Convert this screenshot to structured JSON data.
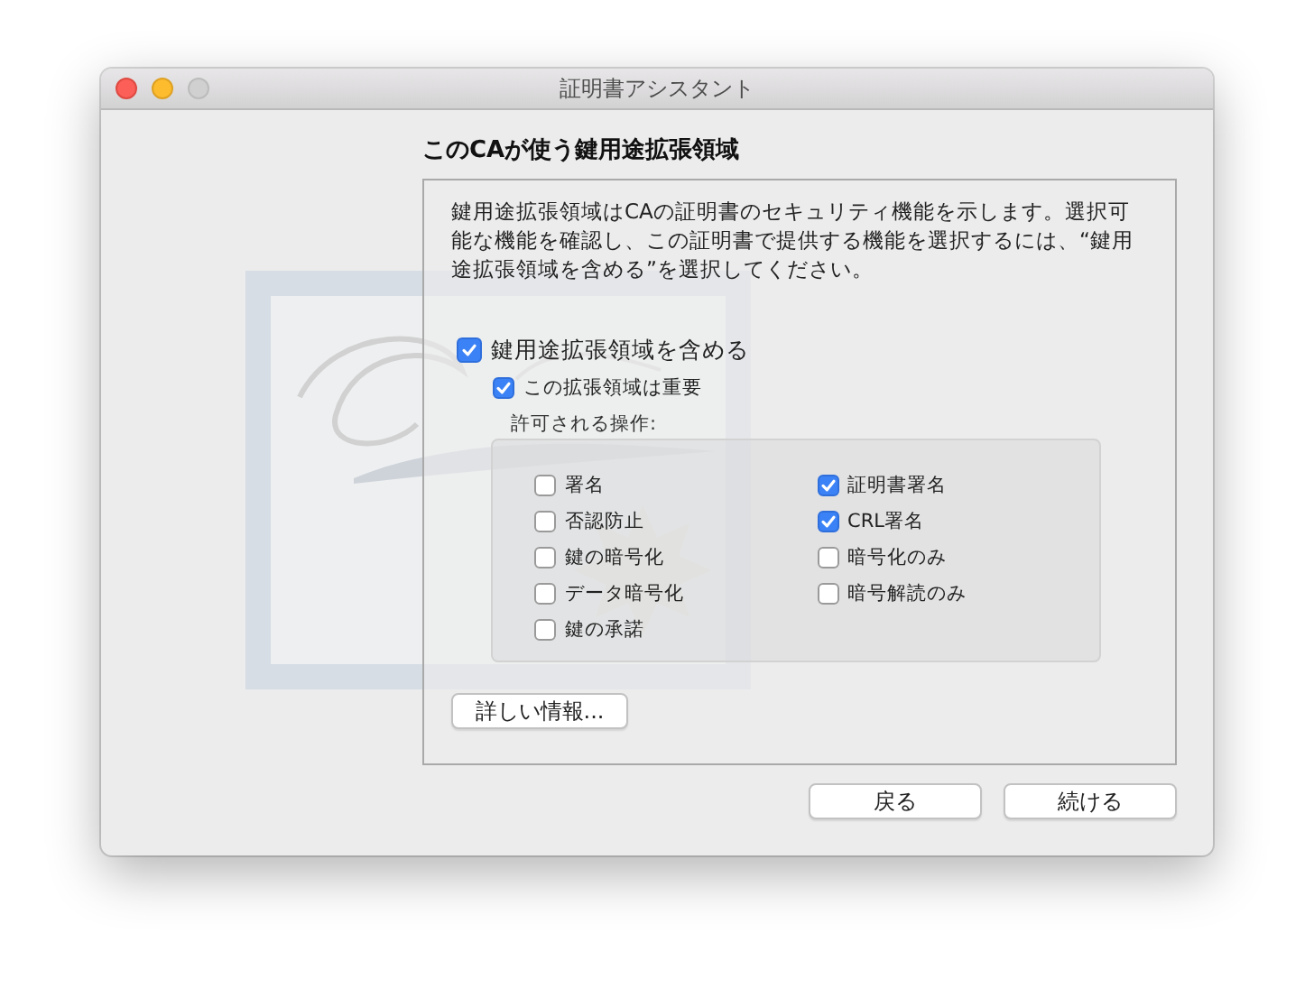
{
  "window": {
    "title": "証明書アシスタント"
  },
  "heading": "このCAが使う鍵用途拡張領域",
  "description": "鍵用途拡張領域はCAの証明書のセキュリティ機能を示します。選択可能な機能を確認し、この証明書で提供する機能を選択するには、“鍵用途拡張領域を含める”を選択してください。",
  "include_extension": {
    "label": "鍵用途拡張領域を含める",
    "checked": true
  },
  "critical": {
    "label": "この拡張領域は重要",
    "checked": true
  },
  "operations_label": "許可される操作:",
  "operations_columns": [
    {
      "items": [
        {
          "label": "署名",
          "checked": false
        },
        {
          "label": "否認防止",
          "checked": false
        },
        {
          "label": "鍵の暗号化",
          "checked": false
        },
        {
          "label": "データ暗号化",
          "checked": false
        },
        {
          "label": "鍵の承諾",
          "checked": false
        }
      ]
    },
    {
      "items": [
        {
          "label": "証明書署名",
          "checked": true
        },
        {
          "label": "CRL署名",
          "checked": true
        },
        {
          "label": "暗号化のみ",
          "checked": false
        },
        {
          "label": "暗号解読のみ",
          "checked": false
        }
      ]
    }
  ],
  "more_info_button": "詳しい情報...",
  "buttons": [
    "戻る",
    "続ける"
  ]
}
